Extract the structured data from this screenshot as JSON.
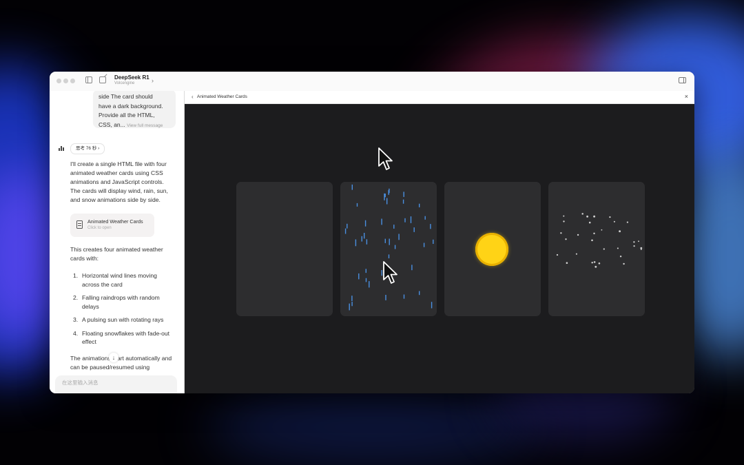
{
  "app": {
    "model_name": "DeepSeek R1",
    "model_provider": "Volcengine"
  },
  "chat": {
    "user_message_lines": [
      "side The card should",
      "have a dark background.",
      "Provide all the HTML,",
      "CSS, an..."
    ],
    "view_full_message": "View full message",
    "thinking_chip": "思考 76 秒",
    "intro": "I'll create a single HTML file with four animated weather cards using CSS animations and JavaScript controls. The cards will display wind, rain, sun, and snow animations side by side.",
    "artifact": {
      "title": "Animated Weather Cards",
      "subtitle": "Click to open"
    },
    "summary_intro": "This creates four animated weather cards with:",
    "features": [
      {
        "num": "1.",
        "text": "Horizontal wind lines moving across the card"
      },
      {
        "num": "2.",
        "text": "Falling raindrops with random delays"
      },
      {
        "num": "3.",
        "text": "A pulsing sun with rotating rays"
      },
      {
        "num": "4.",
        "text": "Floating snowflakes with fade-out effect"
      }
    ],
    "closing": "The animations start automatically and can be paused/resumed using",
    "composer_placeholder": "在这里输入消息"
  },
  "preview": {
    "title": "Animated Weather Cards",
    "back_symbol": "‹",
    "close_symbol": "×",
    "cards": [
      {
        "weather": "wind"
      },
      {
        "weather": "rain"
      },
      {
        "weather": "sun"
      },
      {
        "weather": "snow"
      }
    ]
  },
  "icons": {
    "sidebar_toggle": "sidebar-toggle-icon",
    "new_chat": "new-chat-icon",
    "model_chevron": "chevron-right-icon",
    "panel_toggle": "panel-toggle-icon",
    "thinking": "bars-icon",
    "artifact": "document-icon",
    "scroll": "arrow-down-icon"
  },
  "colors": {
    "preview_background": "#1c1c1e",
    "card_background": "#2d2d2f",
    "rain": "#4a90e2",
    "sun": "#ffd316",
    "snow": "#cfcfcf"
  }
}
